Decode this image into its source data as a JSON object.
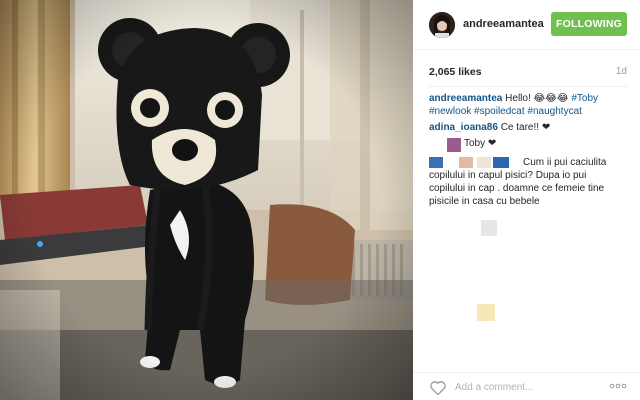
{
  "post": {
    "username": "andreeamantea",
    "follow_label": "FOLLOWING",
    "likes": "2,065 likes",
    "timestamp": "1d"
  },
  "caption": {
    "user": "andreeamantea",
    "text": "Hello! 😂😂😂 ",
    "tags": [
      "#Toby",
      "#newlook",
      "#spoiledcat",
      "#naughtycat"
    ]
  },
  "comments": [
    {
      "user": "adina_ioana86",
      "text": "Ce tare!! ❤"
    },
    {
      "user": "",
      "text": "Toby ❤"
    },
    {
      "user": "",
      "text": "Cum ii pui caciulita copilului in capul pisici? Dupa io pui copilului in cap . doamne ce femeie tine pisicile in casa cu bebele"
    }
  ],
  "add_comment": {
    "placeholder": "Add a comment..."
  },
  "colors": {
    "follow_button": "#70c050",
    "link": "#125688",
    "username_text": "#262626",
    "muted": "#999999"
  },
  "icons": {
    "like": "heart-outline-icon",
    "more": "ellipsis-icon"
  }
}
